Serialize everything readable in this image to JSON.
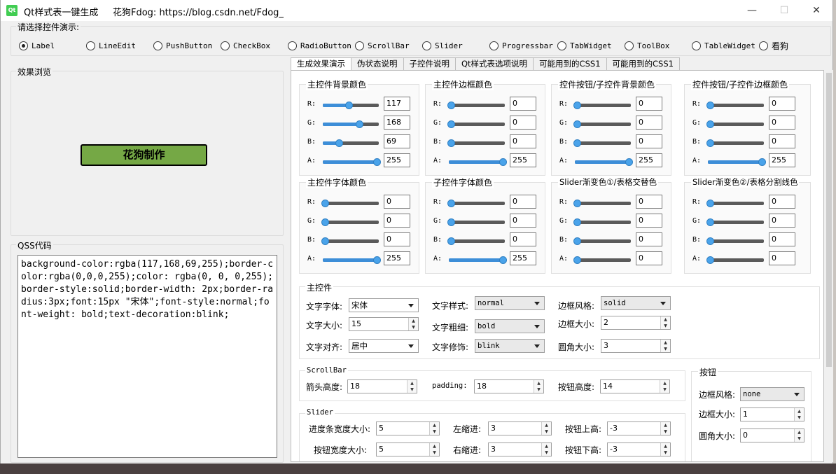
{
  "window": {
    "title": "Qt样式表一键生成     花狗Fdog: https://blog.csdn.net/Fdog_",
    "minimize": "—",
    "maximize": "☐",
    "close": "✕"
  },
  "selector": {
    "label": "请选择控件演示:",
    "options": [
      "Label",
      "LineEdit",
      "PushButton",
      "CheckBox",
      "RadioButton",
      "ScrollBar",
      "Slider",
      "Progressbar",
      "TabWidget",
      "ToolBox",
      "TableWidget",
      "看狗"
    ],
    "selected": "Label"
  },
  "preview": {
    "group_label": "效果浏览",
    "button_text": "花狗制作",
    "button_color": "#75a845"
  },
  "qss": {
    "group_label": "QSS代码",
    "code": "background-color:rgba(117,168,69,255);border-color:rgba(0,0,0,255);color: rgba(0, 0, 0,255);border-style:solid;border-width: 2px;border-radius:3px;font:15px \"宋体\";font-style:normal;font-weight: bold;text-decoration:blink;"
  },
  "tabs": [
    "生成效果演示",
    "伪状态说明",
    "子控件说明",
    "Qt样式表选项说明",
    "可能用到的CSS1",
    "可能用到的CSS1"
  ],
  "active_tab": "生成效果演示",
  "color_groups": [
    {
      "title": "主控件背景颜色",
      "r": 117,
      "g": 168,
      "b": 69,
      "a": 255
    },
    {
      "title": "主控件边框颜色",
      "r": 0,
      "g": 0,
      "b": 0,
      "a": 255
    },
    {
      "title": "控件按钮/子控件背景颜色",
      "r": 0,
      "g": 0,
      "b": 0,
      "a": 255
    },
    {
      "title": "控件按钮/子控件边框颜色",
      "r": 0,
      "g": 0,
      "b": 0,
      "a": 255
    },
    {
      "title": "主控件字体颜色",
      "r": 0,
      "g": 0,
      "b": 0,
      "a": 255
    },
    {
      "title": "子控件字体颜色",
      "r": 0,
      "g": 0,
      "b": 0,
      "a": 255
    },
    {
      "title": "Slider渐变色①/表格交替色",
      "r": 0,
      "g": 0,
      "b": 0,
      "a": 0
    },
    {
      "title": "Slider渐变色②/表格分割线色",
      "r": 0,
      "g": 0,
      "b": 0,
      "a": 0
    }
  ],
  "channel_labels": [
    "R:",
    "G:",
    "B:",
    "A:"
  ],
  "main_widget": {
    "title": "主控件",
    "font_label": "文字字体:",
    "font_value": "宋体",
    "size_label": "文字大小:",
    "size_value": "15",
    "align_label": "文字对齐:",
    "align_value": "居中",
    "style_label": "文字样式:",
    "style_value": "normal",
    "weight_label": "文字粗细:",
    "weight_value": "bold",
    "decor_label": "文字修饰:",
    "decor_value": "blink",
    "border_style_label": "边框风格:",
    "border_style_value": "solid",
    "border_size_label": "边框大小:",
    "border_size_value": "2",
    "radius_label": "圆角大小:",
    "radius_value": "3"
  },
  "scrollbar": {
    "title": "ScrollBar",
    "arrow_label": "箭头高度:",
    "arrow_value": "18",
    "padding_label": "padding:",
    "padding_value": "18",
    "btn_label": "按钮高度:",
    "btn_value": "14"
  },
  "slider": {
    "title": "Slider",
    "groove_label": "进度条宽度大小:",
    "groove_value": "5",
    "left_label": "左缩进:",
    "left_value": "3",
    "up_label": "按钮上高:",
    "up_value": "-3",
    "hwidth_label": "按钮宽度大小:",
    "hwidth_value": "5",
    "right_label": "右缩进:",
    "right_value": "3",
    "down_label": "按钮下高:",
    "down_value": "-3"
  },
  "button_group": {
    "title": "按钮",
    "border_style_label": "边框风格:",
    "border_style_value": "none",
    "border_size_label": "边框大小:",
    "border_size_value": "1",
    "radius_label": "圆角大小:",
    "radius_value": "0"
  },
  "colors": {
    "accent": "#3d8ed8",
    "handle": "#4aa3ea",
    "groove": "#5a5a5a"
  }
}
